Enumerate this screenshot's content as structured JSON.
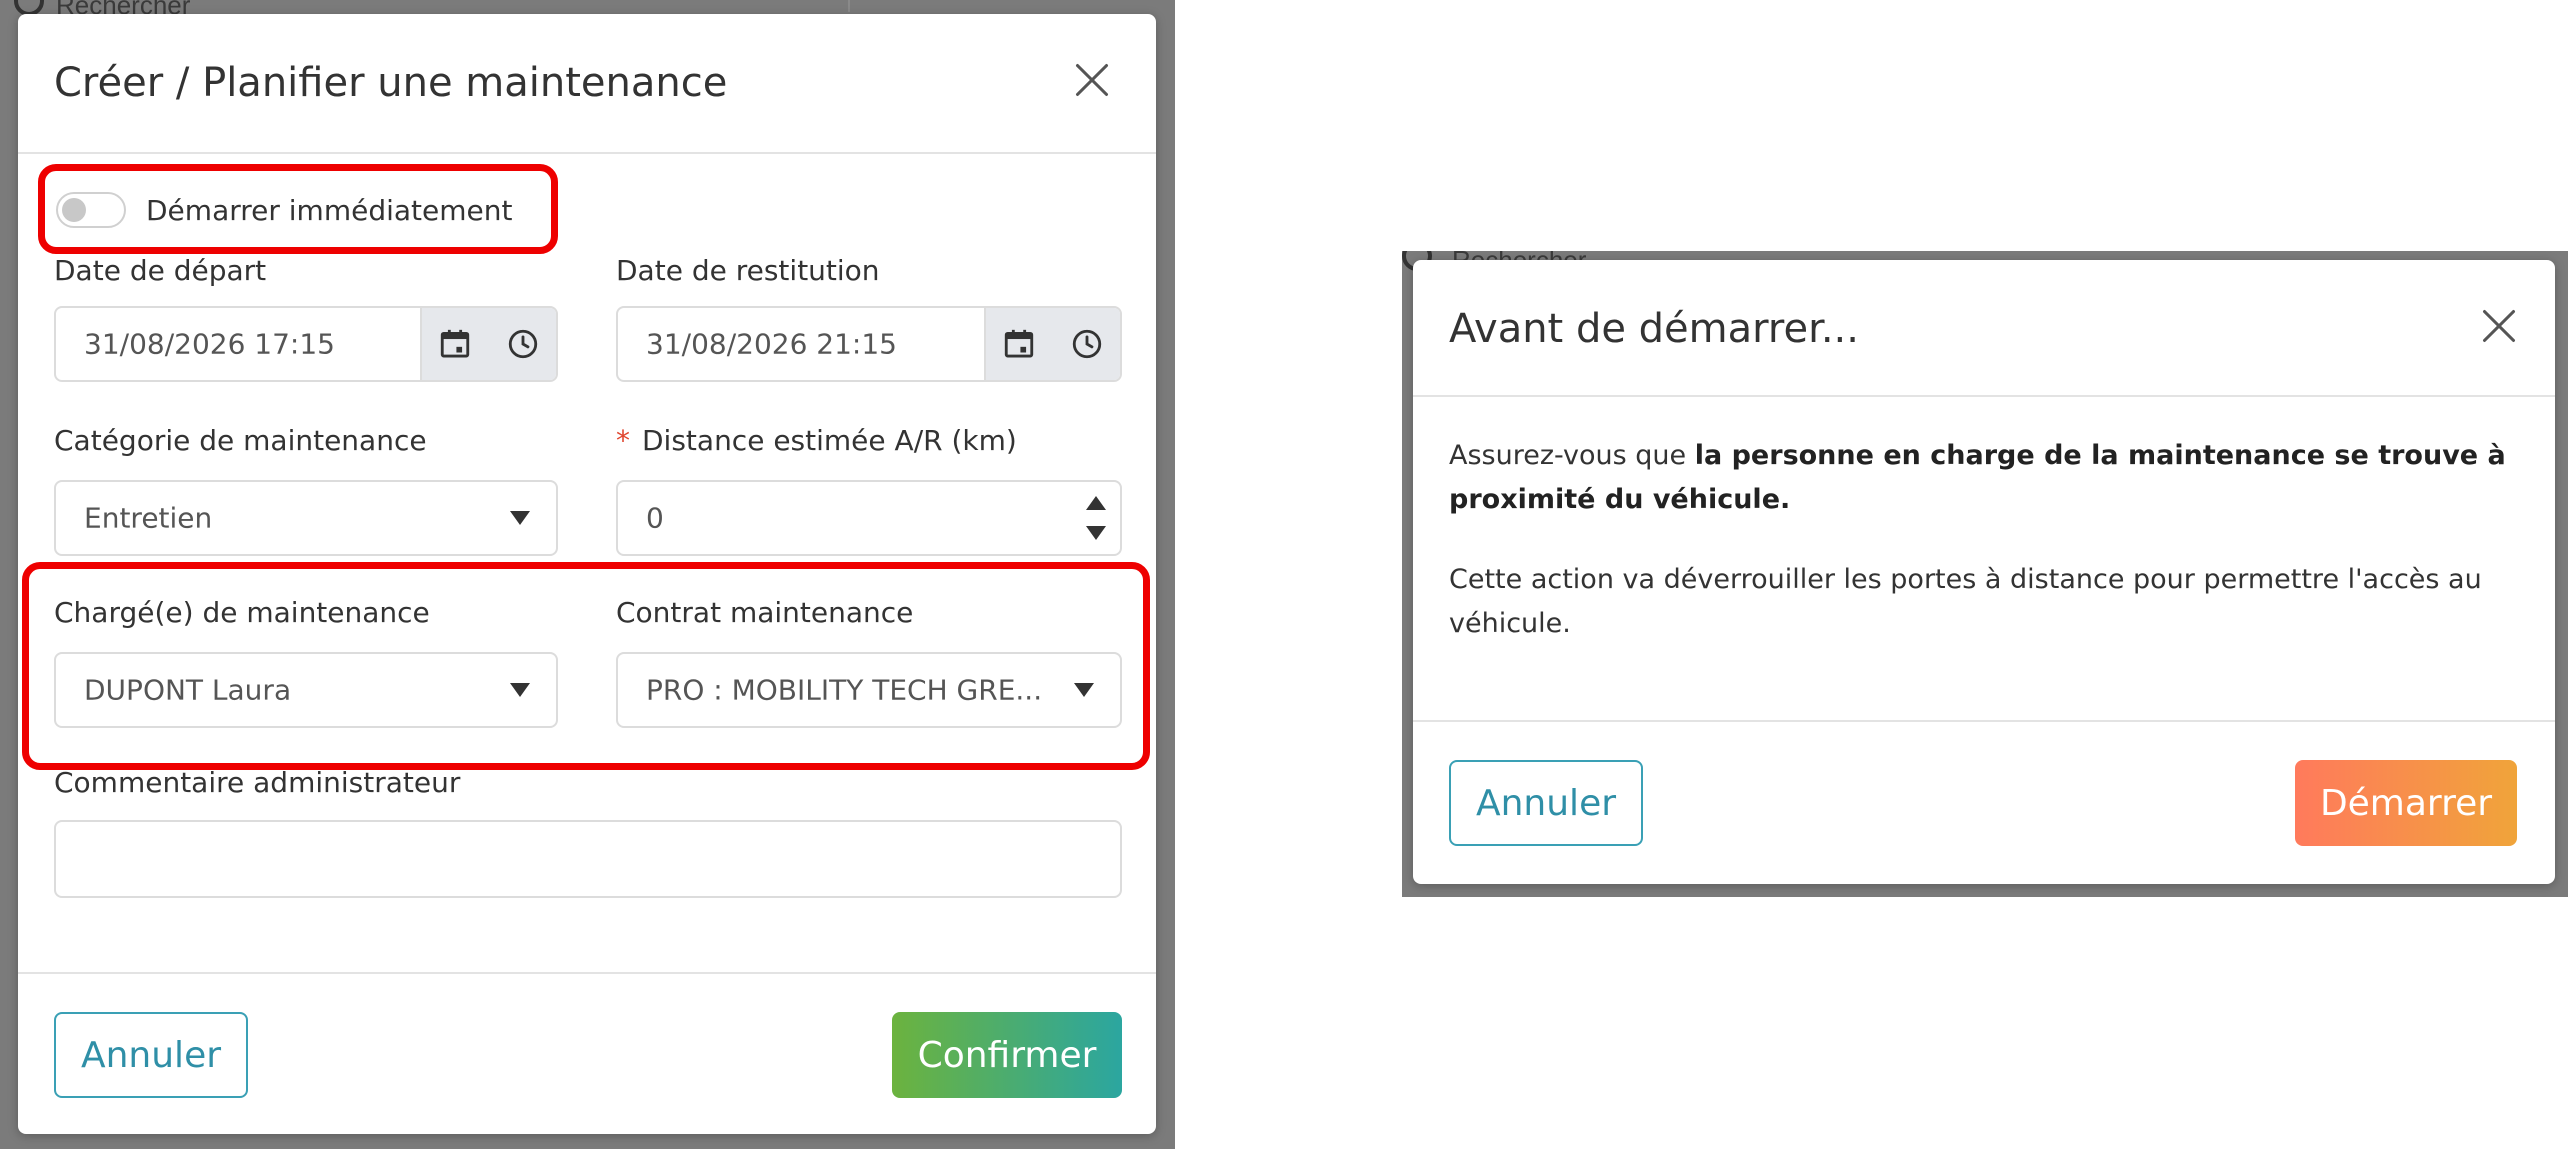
{
  "backdrop_left": {
    "search_text": "Rechercher"
  },
  "backdrop_right": {
    "search_text": "Rechercher"
  },
  "create_modal": {
    "title": "Créer / Planifier une maintenance",
    "start_now_label": "Démarrer immédiatement",
    "start_now_enabled": false,
    "departure_label": "Date de départ",
    "departure_value": "31/08/2026 17:15",
    "return_label": "Date de restitution",
    "return_value": "31/08/2026 21:15",
    "category_label": "Catégorie de maintenance",
    "category_value": "Entretien",
    "distance_required_mark": "*",
    "distance_label": "Distance estimée A/R (km)",
    "distance_value": "0",
    "manager_label": "Chargé(e) de maintenance",
    "manager_value": "DUPONT Laura",
    "contract_label": "Contrat maintenance",
    "contract_value": "PRO : MOBILITY TECH GRE...",
    "comment_label": "Commentaire administrateur",
    "comment_value": "",
    "cancel_label": "Annuler",
    "confirm_label": "Confirmer"
  },
  "confirm_modal": {
    "title": "Avant de démarrer...",
    "text1_prefix": "Assurez-vous que ",
    "text1_bold": "la personne en charge de la maintenance se trouve à proximité du véhicule.",
    "text2": "Cette action va déverrouiller les portes à distance pour permettre l'accès au véhicule.",
    "cancel_label": "Annuler",
    "start_label": "Démarrer"
  },
  "icons": [
    "close-icon",
    "calendar-icon",
    "clock-icon",
    "dropdown-caret-icon",
    "stepper-up-icon",
    "stepper-down-icon"
  ],
  "colors": {
    "highlight": "#ee0000",
    "accent_teal": "#2f8fa7",
    "confirm_gradient": [
      "#6cb33e",
      "#2ba6a0"
    ],
    "start_gradient": [
      "#ff7a5c",
      "#f0a43a"
    ],
    "backdrop": "#7b7b7b"
  }
}
